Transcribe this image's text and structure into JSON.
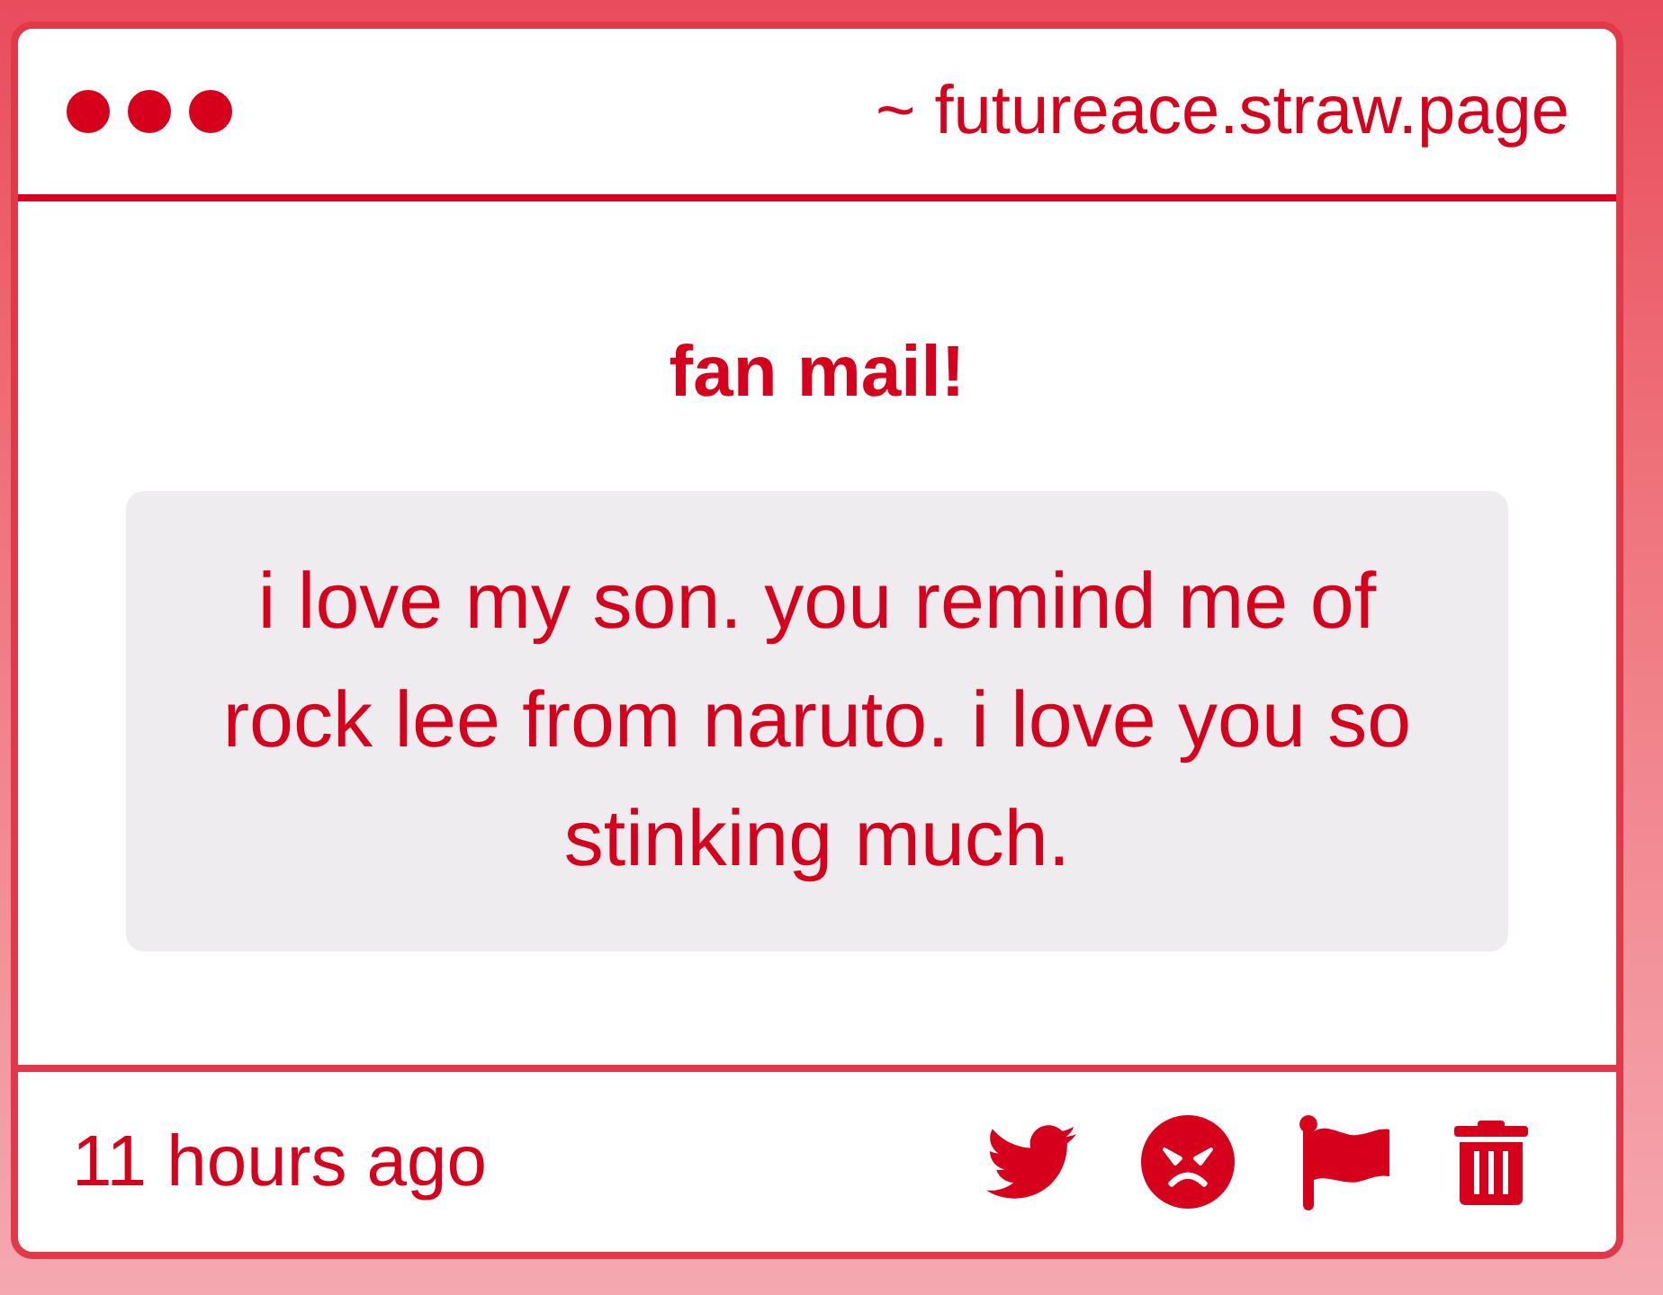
{
  "window": {
    "address": "~ futureace.straw.page"
  },
  "message": {
    "title": "fan mail!",
    "body": "i love my son. you remind me of rock lee from naruto. i love you so stinking much."
  },
  "footer": {
    "time": "11 hours ago",
    "actions": [
      {
        "kind": "bird"
      },
      {
        "kind": "angry-face"
      },
      {
        "kind": "flag"
      },
      {
        "kind": "trash"
      }
    ]
  }
}
